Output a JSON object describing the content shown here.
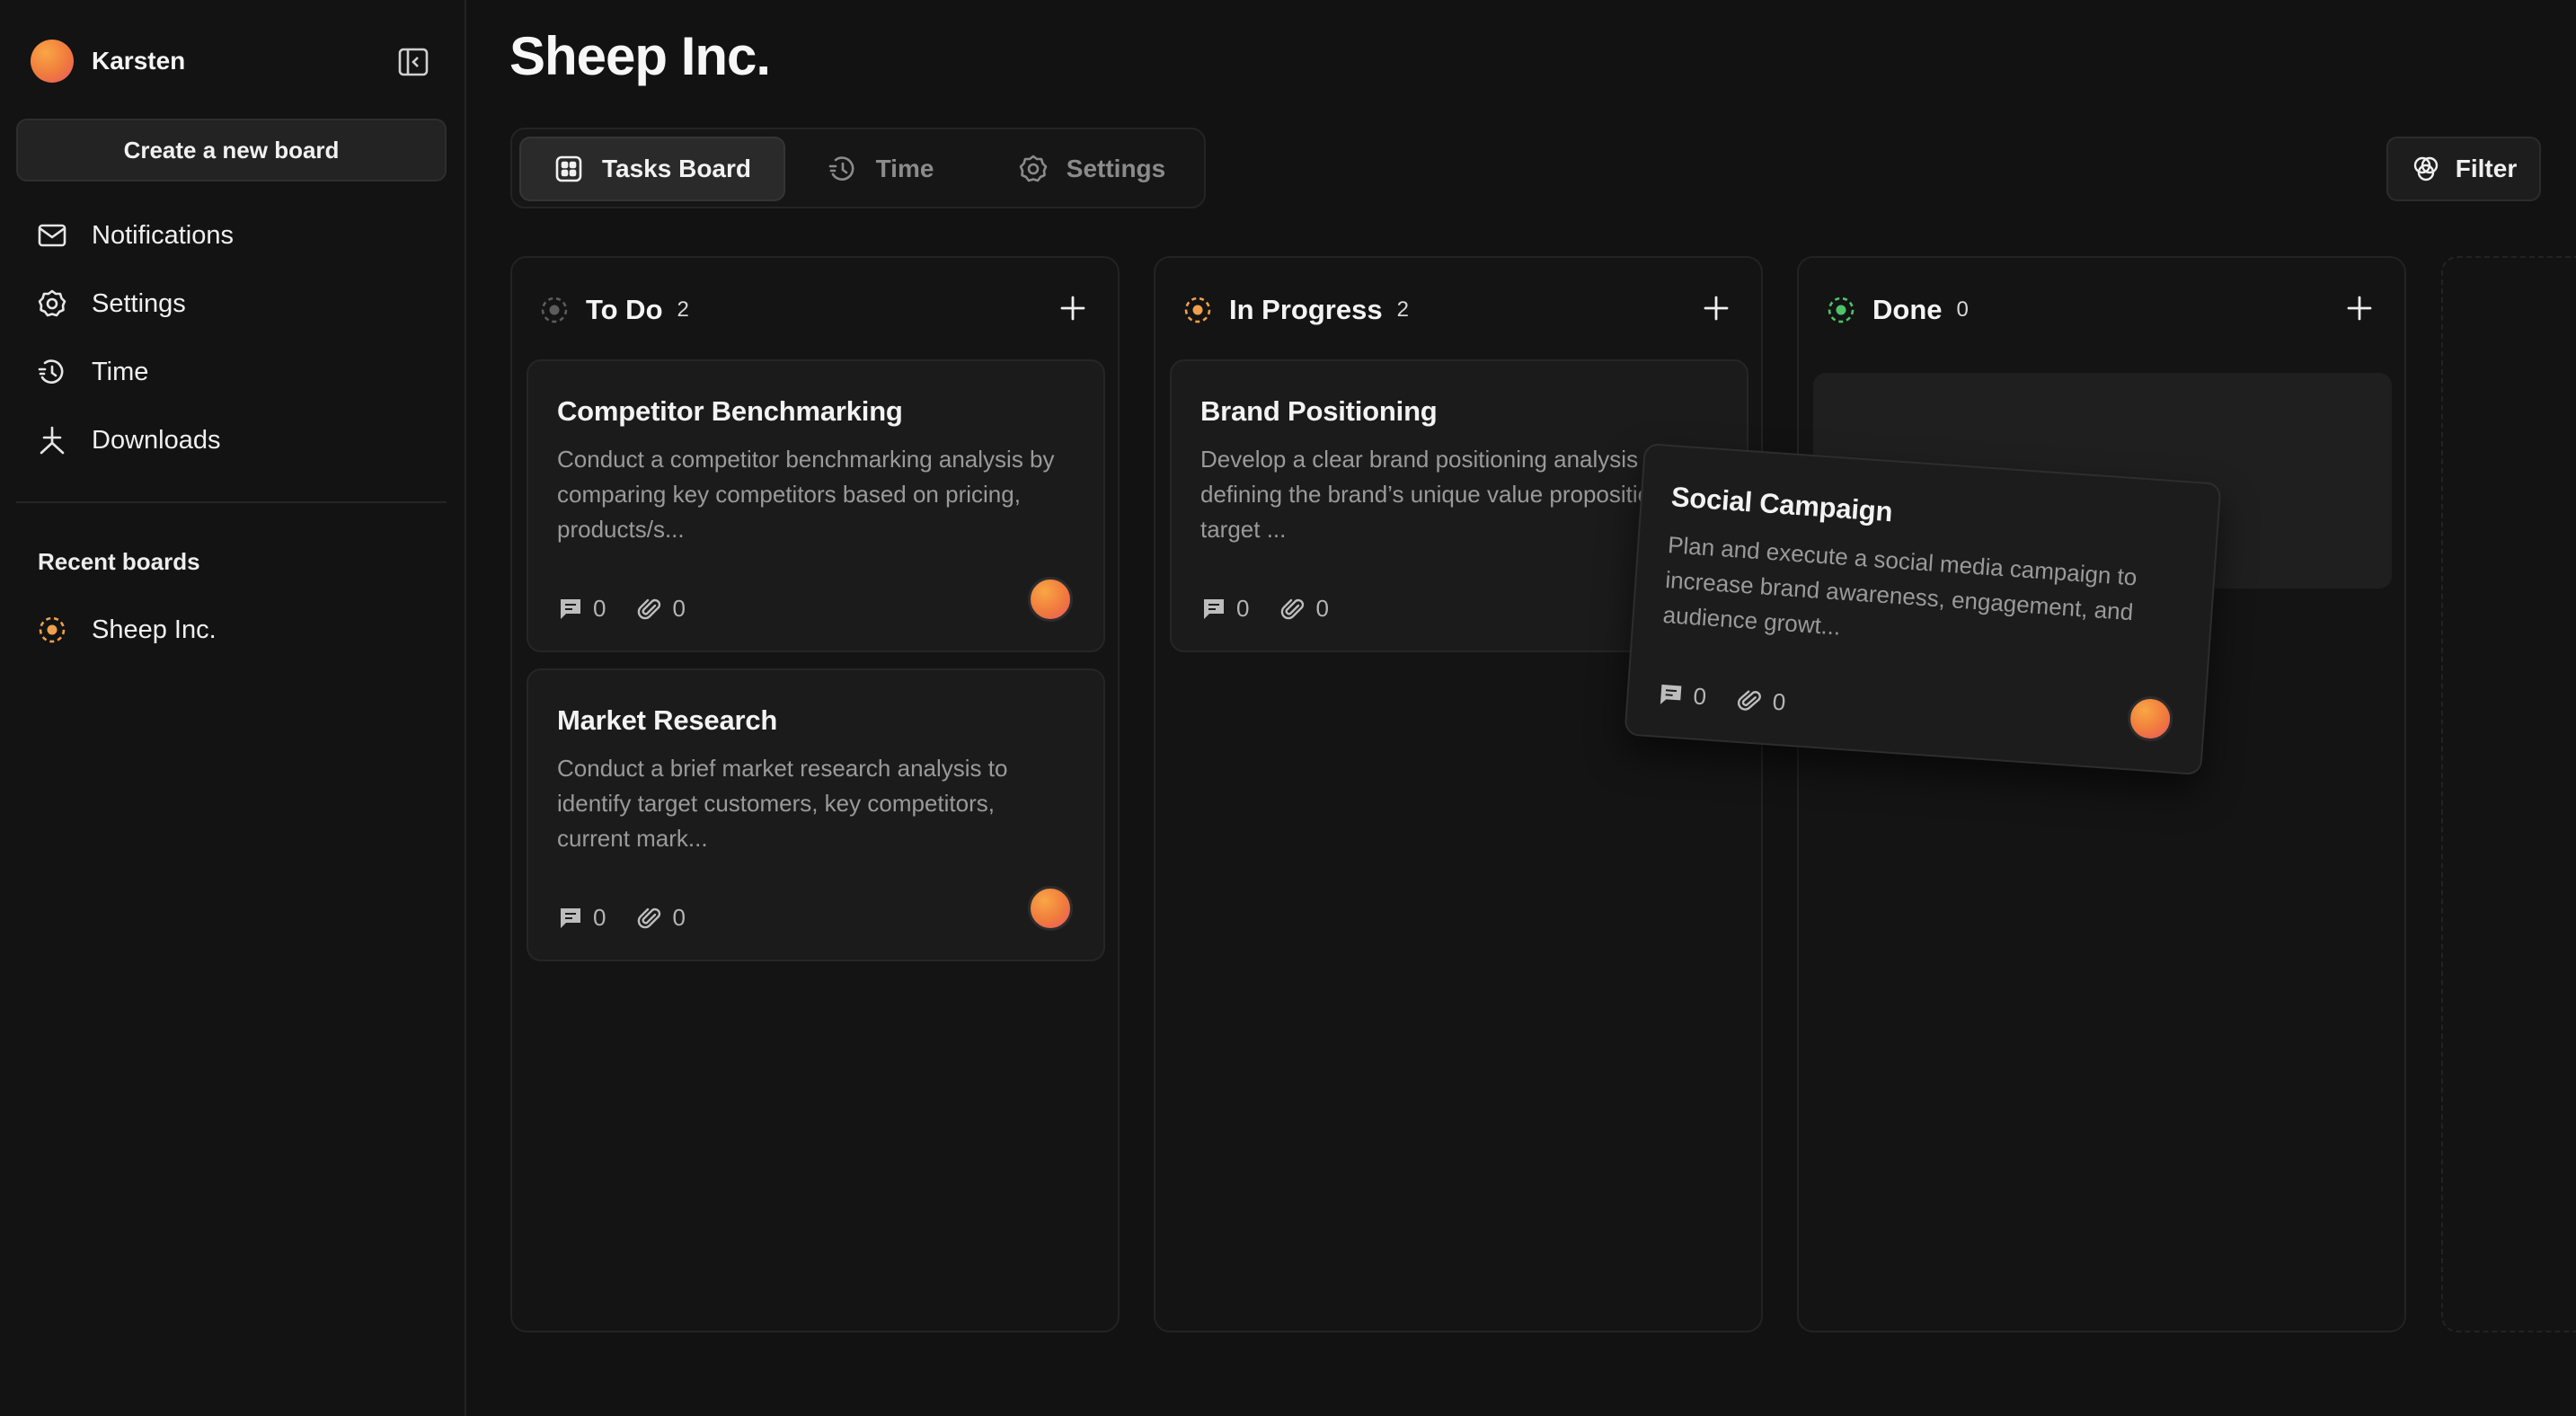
{
  "user": {
    "name": "Karsten"
  },
  "sidebar": {
    "create_label": "Create a new board",
    "nav": [
      {
        "label": "Notifications",
        "icon": "mail-icon"
      },
      {
        "label": "Settings",
        "icon": "gear-icon"
      },
      {
        "label": "Time",
        "icon": "timer-icon"
      },
      {
        "label": "Downloads",
        "icon": "download-icon"
      }
    ],
    "recent_title": "Recent boards",
    "recent": [
      {
        "label": "Sheep Inc."
      }
    ]
  },
  "page": {
    "title": "Sheep Inc."
  },
  "tabs": [
    {
      "label": "Tasks Board",
      "active": true
    },
    {
      "label": "Time",
      "active": false
    },
    {
      "label": "Settings",
      "active": false
    }
  ],
  "filter_label": "Filter",
  "colors": {
    "todo": "#6b6b6b",
    "in_progress": "#f0a04b",
    "done": "#4ec36a",
    "avatar_start": "#f9a645",
    "avatar_end": "#e8536a"
  },
  "columns": [
    {
      "title": "To Do",
      "count": "2",
      "cards": [
        {
          "title": "Competitor Benchmarking",
          "desc": "Conduct a competitor benchmarking analysis by comparing key competitors based on pricing, products/s...",
          "comments": "0",
          "attachments": "0"
        },
        {
          "title": "Market Research",
          "desc": "Conduct a brief market research analysis to identify target customers, key competitors, current mark...",
          "comments": "0",
          "attachments": "0"
        }
      ]
    },
    {
      "title": "In Progress",
      "count": "2",
      "cards": [
        {
          "title": "Brand Positioning",
          "desc": "Develop a clear brand positioning analysis by defining the brand’s unique value proposition, target ...",
          "comments": "0",
          "attachments": "0"
        }
      ]
    },
    {
      "title": "Done",
      "count": "0",
      "cards": []
    }
  ],
  "dragging_card": {
    "title": "Social Campaign",
    "desc": "Plan and execute a social media campaign to increase brand awareness, engagement, and audience growt...",
    "comments": "0",
    "attachments": "0"
  }
}
